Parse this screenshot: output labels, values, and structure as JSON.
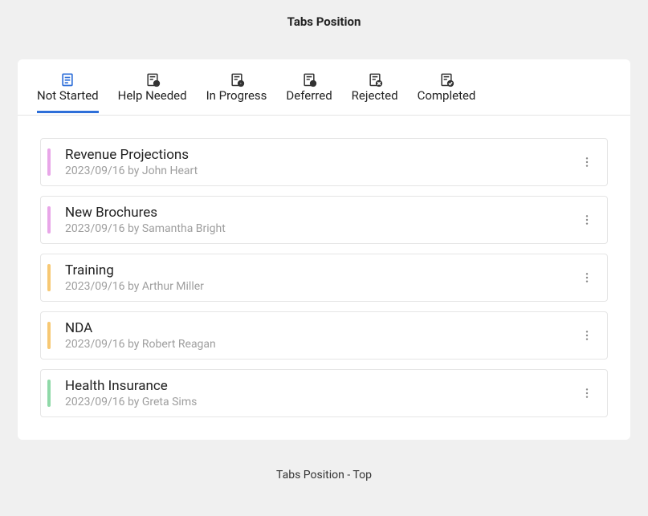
{
  "page_title": "Tabs Position",
  "footer": "Tabs Position - Top",
  "tabs": [
    {
      "label": "Not Started",
      "icon": "not-started",
      "active": true
    },
    {
      "label": "Help Needed",
      "icon": "help-needed",
      "active": false
    },
    {
      "label": "In Progress",
      "icon": "in-progress",
      "active": false
    },
    {
      "label": "Deferred",
      "icon": "deferred",
      "active": false
    },
    {
      "label": "Rejected",
      "icon": "rejected",
      "active": false
    },
    {
      "label": "Completed",
      "icon": "completed",
      "active": false
    }
  ],
  "tasks": [
    {
      "title": "Revenue Projections",
      "meta": "2023/09/16 by John Heart",
      "color": "#e8a6e8"
    },
    {
      "title": "New Brochures",
      "meta": "2023/09/16 by Samantha Bright",
      "color": "#e8a6e8"
    },
    {
      "title": "Training",
      "meta": "2023/09/16 by Arthur Miller",
      "color": "#f7c873"
    },
    {
      "title": "NDA",
      "meta": "2023/09/16 by Robert Reagan",
      "color": "#f7c873"
    },
    {
      "title": "Health Insurance",
      "meta": "2023/09/16 by Greta Sims",
      "color": "#8fd9a8"
    }
  ]
}
